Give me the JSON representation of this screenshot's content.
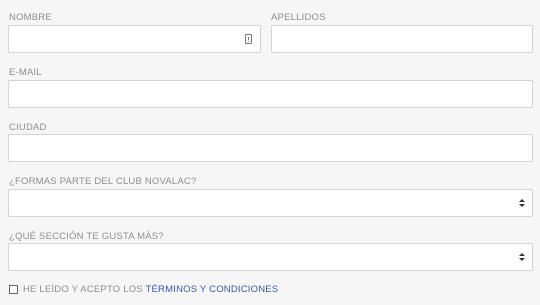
{
  "form": {
    "nombre_label": "NOMBRE",
    "apellidos_label": "APELLIDOS",
    "email_label": "E-MAIL",
    "ciudad_label": "CIUDAD",
    "club_label": "¿FORMAS PARTE DEL CLUB NOVALAC?",
    "seccion_label": "¿QUÉ SECCIÓN TE GUSTA MÁS?",
    "nombre_value": "",
    "apellidos_value": "",
    "email_value": "",
    "ciudad_value": "",
    "club_selected": "",
    "seccion_selected": ""
  },
  "terms": {
    "prefix": "HE LEÍDO Y ACEPTO LOS ",
    "link": "TÉRMINOS Y CONDICIONES"
  },
  "colors": {
    "background": "#f6f6f6",
    "field_border": "#d4d4d4",
    "label": "#8e8e8e",
    "link": "#3a5aa0"
  },
  "icons": {
    "nombre_field": "id-card-icon",
    "selects": "select-arrows-icon"
  }
}
